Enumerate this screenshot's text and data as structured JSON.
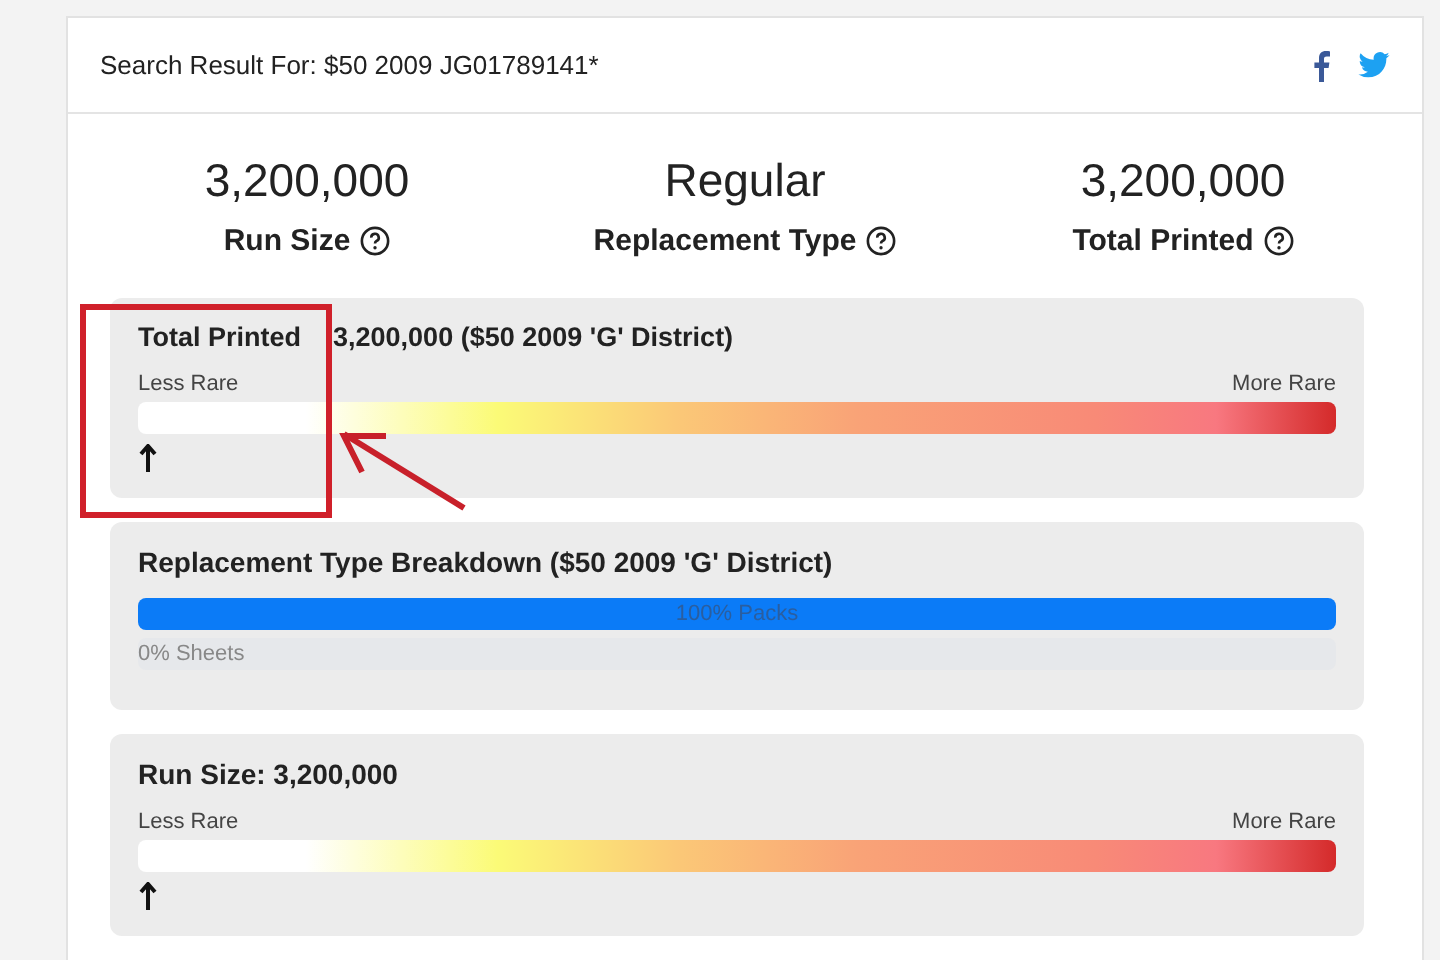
{
  "header": {
    "title": "Search Result For: $50 2009 JG01789141*"
  },
  "stats": [
    {
      "value": "3,200,000",
      "label": "Run Size"
    },
    {
      "value": "Regular",
      "label": "Replacement Type"
    },
    {
      "value": "3,200,000",
      "label": "Total Printed"
    }
  ],
  "panels": [
    {
      "kind": "scale",
      "title": "Total Printed",
      "title_value": "3,200,000 ($50 2009 'G' District)",
      "low_label": "Less Rare",
      "high_label": "More Rare",
      "level": 0
    },
    {
      "kind": "breakdown",
      "title": "Replacement Type Breakdown ($50 2009 'G' District)",
      "bars": [
        {
          "label": "100% Packs",
          "level": 1
        },
        {
          "label": "0% Sheets",
          "level": 0
        }
      ]
    },
    {
      "kind": "scale",
      "title": "Run Size: 3,200,000",
      "low_label": "Less Rare",
      "high_label": "More Rare",
      "level": 0
    }
  ]
}
